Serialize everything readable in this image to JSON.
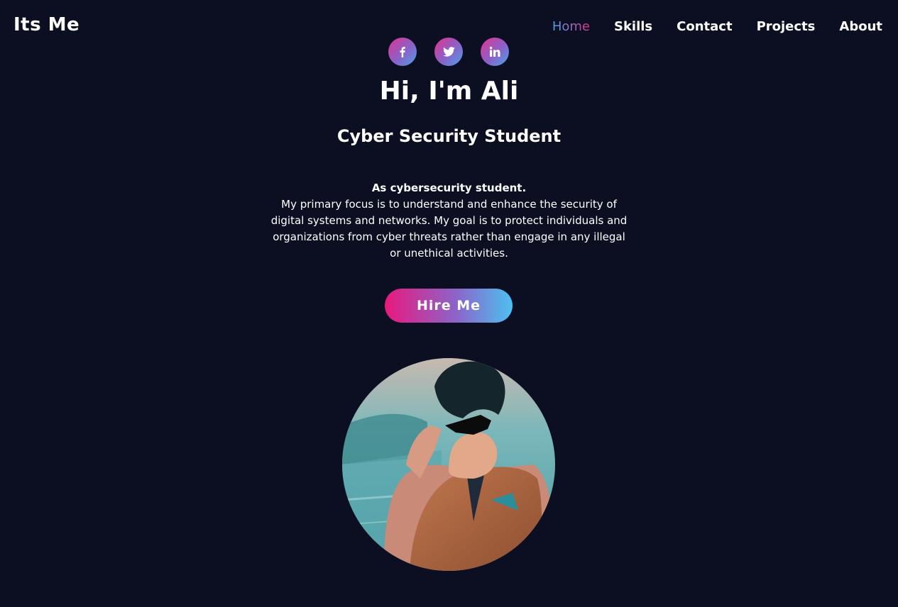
{
  "header": {
    "brand": "Its Me",
    "nav": [
      {
        "label": "Home",
        "active": true
      },
      {
        "label": "Skills"
      },
      {
        "label": "Contact"
      },
      {
        "label": "Projects"
      },
      {
        "label": "About"
      }
    ]
  },
  "socials": [
    {
      "icon": "facebook-icon"
    },
    {
      "icon": "twitter-icon"
    },
    {
      "icon": "linkedin-icon"
    }
  ],
  "hero": {
    "title": "Hi, I'm Ali",
    "subtitle": "Cyber Security Student",
    "lead": "As cybersecurity student.",
    "body": "My primary focus is to understand and enhance the security of digital systems and networks. My goal is to protect individuals and organizations from cyber threats rather than engage in any illegal or unethical activities.",
    "cta": "Hire Me"
  },
  "colors": {
    "background": "#0c0f21",
    "gradient_pink": "#e8197d",
    "gradient_purple": "#8d63c8",
    "gradient_blue": "#4dc0f0"
  }
}
